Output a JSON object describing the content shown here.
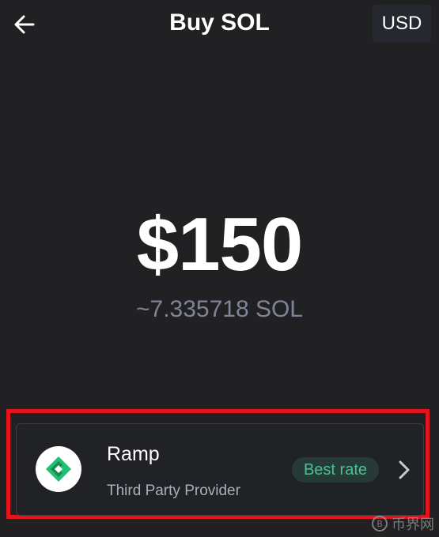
{
  "header": {
    "title": "Buy SOL",
    "currency": "USD",
    "back_icon": "arrow-left-icon"
  },
  "amount": {
    "fiat": "$150",
    "crypto": "~7.335718 SOL"
  },
  "provider": {
    "name": "Ramp",
    "subtitle": "Third Party Provider",
    "badge": "Best rate",
    "logo_icon": "ramp-logo-icon",
    "chevron_icon": "chevron-right-icon"
  },
  "watermark": {
    "text": "币界网"
  },
  "colors": {
    "background": "#212124",
    "badge_text": "#4cbf98",
    "highlight": "#e5141c",
    "muted_text": "#7e8597"
  }
}
